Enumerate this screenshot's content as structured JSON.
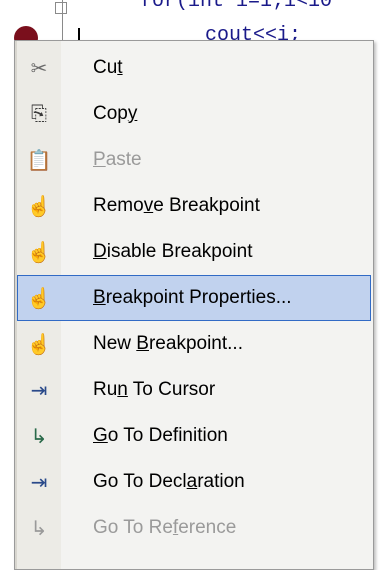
{
  "code": {
    "line1": "for(int i=1;i<10",
    "line2": "cout<<i;"
  },
  "menu": {
    "items": [
      {
        "pre": "Cu",
        "ul": "t",
        "post": "",
        "icon": "scissors-icon",
        "glyph": "✂",
        "color": "#6a6a6a",
        "disabled": false,
        "selected": false
      },
      {
        "pre": "Cop",
        "ul": "y",
        "post": "",
        "icon": "copy-icon",
        "glyph": "⎘",
        "color": "#3a3a3a",
        "disabled": false,
        "selected": false
      },
      {
        "pre": "",
        "ul": "P",
        "post": "aste",
        "icon": "paste-icon",
        "glyph": "📋",
        "color": "#8a8a8a",
        "disabled": true,
        "selected": false
      },
      {
        "pre": "Remo",
        "ul": "v",
        "post": "e Breakpoint",
        "icon": "hand-icon",
        "glyph": "☝",
        "color": "#5a5a5a",
        "disabled": false,
        "selected": false
      },
      {
        "pre": "",
        "ul": "D",
        "post": "isable Breakpoint",
        "icon": "hand-disabled-icon",
        "glyph": "☝",
        "color": "#7a7a7a",
        "disabled": false,
        "selected": false
      },
      {
        "pre": "",
        "ul": "B",
        "post": "reakpoint Properties...",
        "icon": "breakpoint-properties-icon",
        "glyph": "☝",
        "color": "#2a4a8a",
        "disabled": false,
        "selected": true
      },
      {
        "pre": "New ",
        "ul": "B",
        "post": "reakpoint...",
        "icon": "new-breakpoint-icon",
        "glyph": "☝",
        "color": "#4a6a9a",
        "disabled": false,
        "selected": false
      },
      {
        "pre": "Ru",
        "ul": "n",
        "post": " To Cursor",
        "icon": "run-to-cursor-icon",
        "glyph": "⇥",
        "color": "#2a4a8a",
        "disabled": false,
        "selected": false
      },
      {
        "pre": "",
        "ul": "G",
        "post": "o To Definition",
        "icon": "go-to-definition-icon",
        "glyph": "↳",
        "color": "#2a6a4a",
        "disabled": false,
        "selected": false
      },
      {
        "pre": "Go To Decl",
        "ul": "a",
        "post": "ration",
        "icon": "go-to-declaration-icon",
        "glyph": "⇥",
        "color": "#2a4a8a",
        "disabled": false,
        "selected": false
      },
      {
        "pre": "Go To Re",
        "ul": "f",
        "post": "erence",
        "icon": "go-to-reference-icon",
        "glyph": "↳",
        "color": "#9a9a9a",
        "disabled": true,
        "selected": false
      }
    ]
  }
}
